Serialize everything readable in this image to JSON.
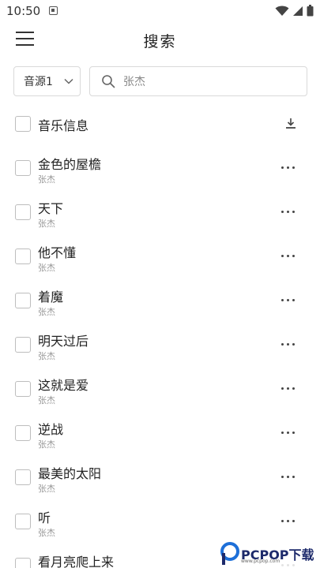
{
  "status_bar": {
    "time": "10:50",
    "notification_icon": "android-notification-icon",
    "wifi_icon": "wifi-icon",
    "signal_icon": "cellular-signal-icon",
    "battery_icon": "battery-icon"
  },
  "header": {
    "menu_icon": "hamburger-menu-icon",
    "title": "搜索"
  },
  "search": {
    "source_value": "音源1",
    "source_icon": "chevron-down-icon",
    "search_icon": "search-icon",
    "query": "张杰"
  },
  "list_header": {
    "label": "音乐信息",
    "download_icon": "download-icon"
  },
  "songs": [
    {
      "title": "金色的屋檐",
      "artist": "张杰"
    },
    {
      "title": "天下",
      "artist": "张杰"
    },
    {
      "title": "他不懂",
      "artist": "张杰"
    },
    {
      "title": "着魔",
      "artist": "张杰"
    },
    {
      "title": "明天过后",
      "artist": "张杰"
    },
    {
      "title": "这就是爱",
      "artist": "张杰"
    },
    {
      "title": "逆战",
      "artist": "张杰"
    },
    {
      "title": "最美的太阳",
      "artist": "张杰"
    },
    {
      "title": "听",
      "artist": "张杰"
    },
    {
      "title": "看月亮爬上来",
      "artist": ""
    }
  ],
  "watermark": {
    "text": "PCPOP下载",
    "sub": "www.pcpop.com"
  },
  "colors": {
    "border": "#d9d9d9",
    "checkbox_border": "#bdbdbd",
    "secondary_text": "#999999",
    "watermark_brand": "#1d2a6b"
  }
}
